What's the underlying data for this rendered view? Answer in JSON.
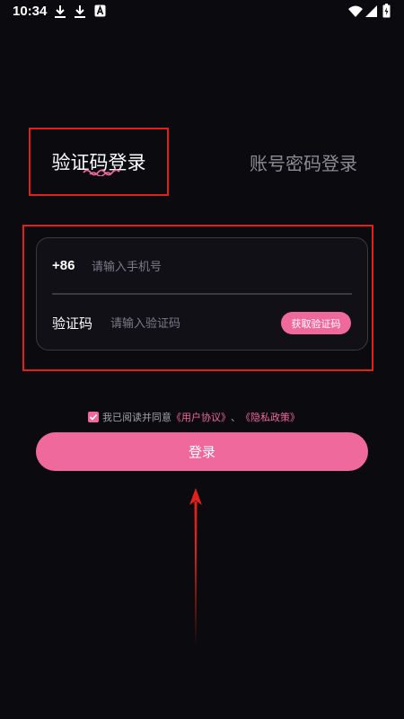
{
  "status_bar": {
    "time": "10:34",
    "icons": [
      "download-icon",
      "download-icon",
      "notification-a-icon",
      "wifi-icon",
      "signal-icon",
      "battery-icon"
    ]
  },
  "tabs": {
    "sms_login": "验证码登录",
    "password_login": "账号密码登录"
  },
  "form": {
    "country_code": "+86",
    "phone_placeholder": "请输入手机号",
    "phone_value": "",
    "code_label": "验证码",
    "code_placeholder": "请输入验证码",
    "code_value": "",
    "get_code_button": "获取验证码"
  },
  "agreement": {
    "checked": true,
    "prefix": "我已阅读并同意",
    "user_agreement": "《用户协议》",
    "separator": "、",
    "privacy_policy": "《隐私政策》"
  },
  "login_button": "登录",
  "colors": {
    "background": "#0b0a0f",
    "accent": "#f0699c",
    "annotation_red": "#e0221c",
    "muted_text": "#8d8b92"
  }
}
